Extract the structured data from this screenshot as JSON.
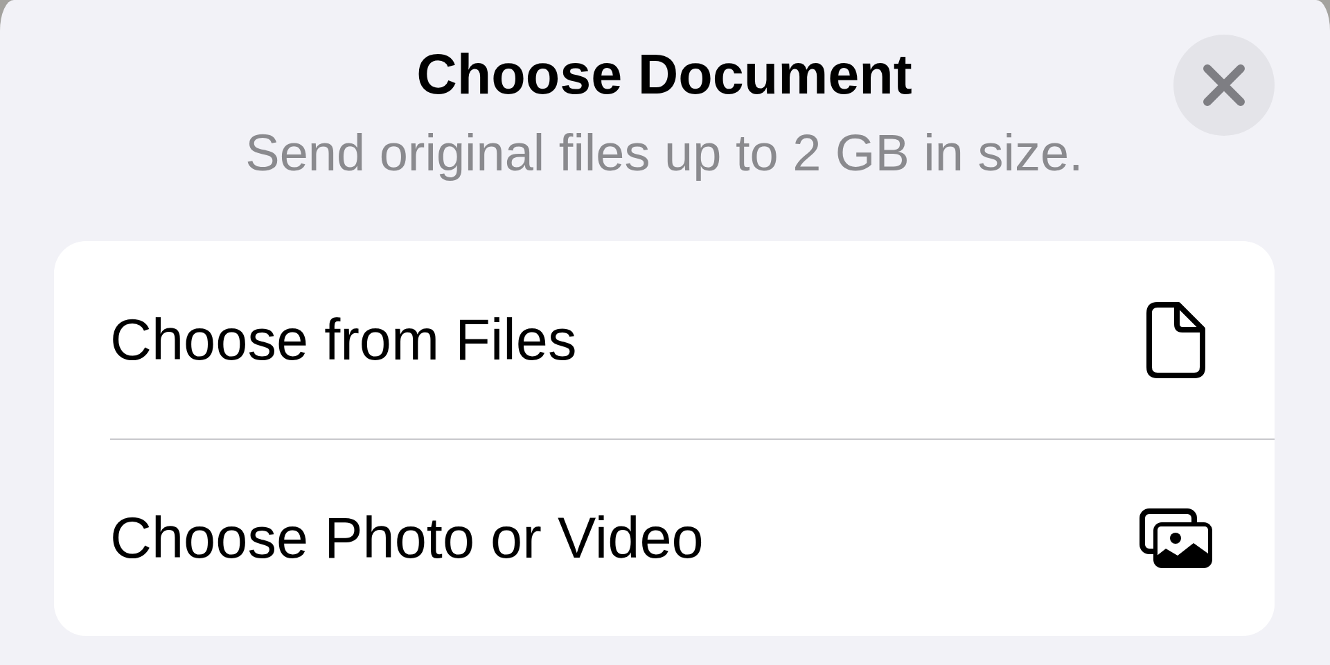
{
  "sheet": {
    "title": "Choose Document",
    "subtitle": "Send original files up to 2 GB in size."
  },
  "options": [
    {
      "label": "Choose from Files",
      "kind": "file"
    },
    {
      "label": "Choose Photo or Video",
      "kind": "media"
    }
  ]
}
